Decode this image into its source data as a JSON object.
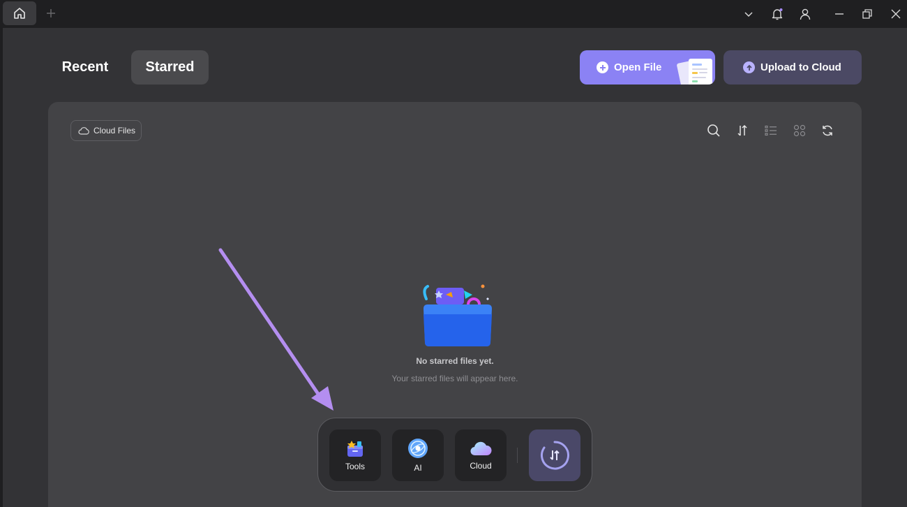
{
  "titlebar": {
    "home_icon": "home-icon",
    "new_tab_icon": "plus-icon",
    "controls": [
      "chevron-down-icon",
      "bell-icon",
      "user-icon",
      "minimize-icon",
      "restore-icon",
      "close-icon"
    ]
  },
  "header": {
    "tabs": [
      {
        "label": "Recent",
        "active": false
      },
      {
        "label": "Starred",
        "active": true
      }
    ],
    "open_file_label": "Open File",
    "upload_label": "Upload to Cloud"
  },
  "panel": {
    "cloud_files_label": "Cloud Files",
    "toolbar_icons": [
      "search-icon",
      "sort-icon",
      "list-view-icon",
      "grid-view-icon",
      "refresh-icon"
    ],
    "empty_title": "No starred files yet.",
    "empty_subtitle": "Your starred files will appear here."
  },
  "dock": {
    "items": [
      {
        "label": "Tools",
        "icon": "tools-icon"
      },
      {
        "label": "AI",
        "icon": "ai-icon"
      },
      {
        "label": "Cloud",
        "icon": "cloud-icon"
      }
    ],
    "toggle_icon": "collapse-icon"
  },
  "colors": {
    "accent": "#8b82f4",
    "upload_bg": "#4b4964",
    "panel_bg": "#434346",
    "page_bg": "#333336",
    "annotation_arrow": "#b48ef0"
  }
}
